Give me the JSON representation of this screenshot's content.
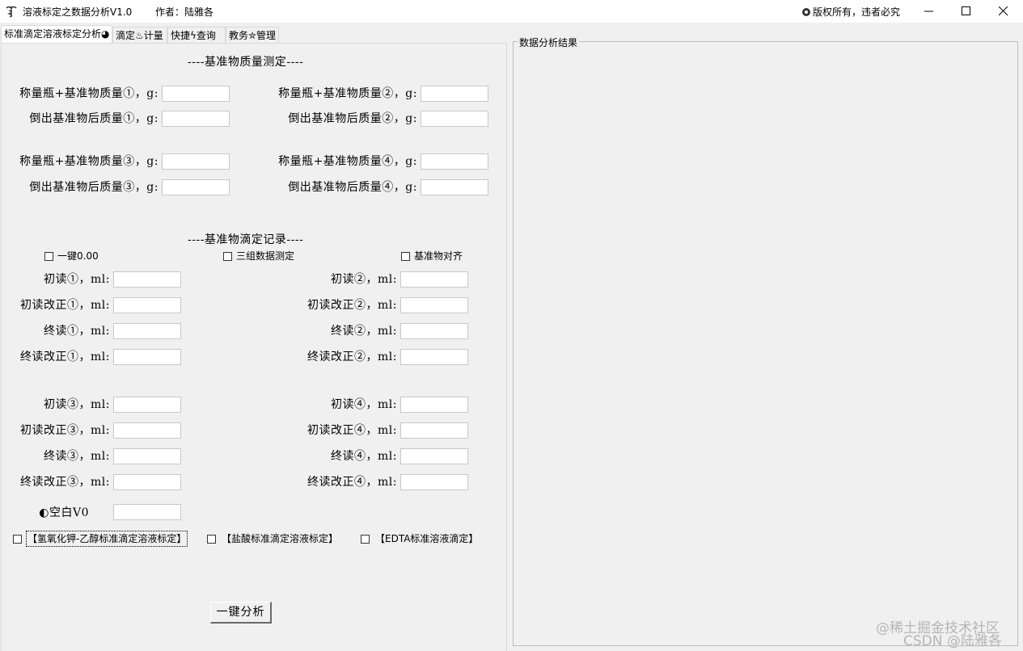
{
  "window": {
    "title": "溶液标定之数据分析V1.0",
    "author": "作者：陆雅各",
    "copyright": "版权所有，违者必究"
  },
  "tabs": [
    {
      "label": "标准滴定溶液标定分析◕",
      "active": true
    },
    {
      "label": "滴定♨计量",
      "active": false
    },
    {
      "label": "快捷ϟ查询",
      "active": false
    },
    {
      "label": "教务✮管理",
      "active": false
    }
  ],
  "mass": {
    "title": "----基准物质量测定----",
    "fields": [
      {
        "label": "称量瓶+基准物质量①，g:",
        "value": ""
      },
      {
        "label": "称量瓶+基准物质量②，g:",
        "value": ""
      },
      {
        "label": "倒出基准物后质量①，g:",
        "value": ""
      },
      {
        "label": "倒出基准物后质量②，g:",
        "value": ""
      },
      {
        "label": "称量瓶+基准物质量③，g:",
        "value": ""
      },
      {
        "label": "称量瓶+基准物质量④，g:",
        "value": ""
      },
      {
        "label": "倒出基准物后质量③，g:",
        "value": ""
      },
      {
        "label": "倒出基准物后质量④，g:",
        "value": ""
      }
    ]
  },
  "titration": {
    "title": "----基准物滴定记录----",
    "options": [
      {
        "label": "一键0.00",
        "checked": false
      },
      {
        "label": "三组数据测定",
        "checked": false
      },
      {
        "label": "基准物对齐",
        "checked": false
      }
    ],
    "fields": [
      {
        "label": "初读①，ml:",
        "value": ""
      },
      {
        "label": "初读②，ml:",
        "value": ""
      },
      {
        "label": "初读改正①，ml:",
        "value": ""
      },
      {
        "label": "初读改正②，ml:",
        "value": ""
      },
      {
        "label": "终读①，ml:",
        "value": ""
      },
      {
        "label": "终读②，ml:",
        "value": ""
      },
      {
        "label": "终读改正①，ml:",
        "value": ""
      },
      {
        "label": "终读改正②，ml:",
        "value": ""
      },
      {
        "label": "初读③，ml:",
        "value": ""
      },
      {
        "label": "初读④，ml:",
        "value": ""
      },
      {
        "label": "初读改正③，ml:",
        "value": ""
      },
      {
        "label": "初读改正④，ml:",
        "value": ""
      },
      {
        "label": "终读③，ml:",
        "value": ""
      },
      {
        "label": "终读④，ml:",
        "value": ""
      },
      {
        "label": "终读改正③，ml:",
        "value": ""
      },
      {
        "label": "终读改正④，ml:",
        "value": ""
      }
    ],
    "blank_label": "◐空白V0",
    "blank_value": ""
  },
  "methods": [
    {
      "label": "【氢氧化钾-乙醇标准滴定溶液标定】",
      "checked": false
    },
    {
      "label": "【盐酸标准滴定溶液标定】",
      "checked": false
    },
    {
      "label": "【EDTA标准溶液滴定】",
      "checked": false
    }
  ],
  "analyze_button": "一键分析",
  "results": {
    "title": "数据分析结果"
  },
  "watermark": {
    "line1": "@稀土掘金技术社区",
    "line2": "CSDN @陆雅各"
  }
}
